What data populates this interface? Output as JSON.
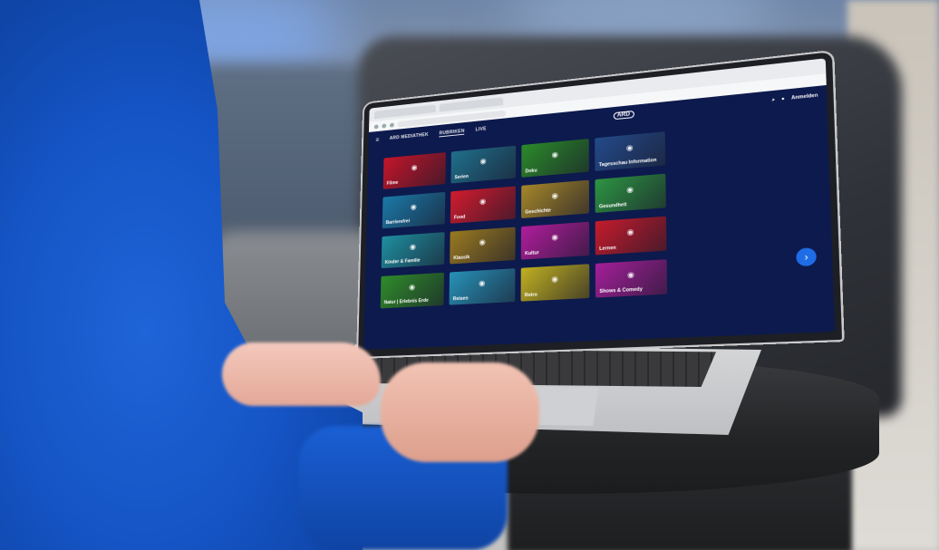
{
  "scene": {
    "description_colors": {
      "sleeve": "#1555c6",
      "screen_bg": "#0d1a4d",
      "accent_button": "#1f6de6"
    }
  },
  "app": {
    "nav": {
      "brand": "ARD MEDIATHEK",
      "items": [
        {
          "label": "RUBRIKEN",
          "active": true
        },
        {
          "label": "LIVE",
          "active": false
        }
      ],
      "logo": "ARD",
      "login": "Anmelden"
    },
    "tiles": [
      {
        "label": "Filme",
        "icon": "film-icon",
        "color": "#c4152a"
      },
      {
        "label": "Serien",
        "icon": "person-icon",
        "color": "#1f6f8c"
      },
      {
        "label": "Doku",
        "icon": "camera-icon",
        "color": "#2b8a2a"
      },
      {
        "label": "Tagesschau Information",
        "icon": "news-icon",
        "color": "#234a8a"
      },
      {
        "label": "Barrierefrei",
        "icon": "accessibility-icon",
        "color": "#1b79a8"
      },
      {
        "label": "Food",
        "icon": "food-icon",
        "color": "#d21b2e"
      },
      {
        "label": "Geschichte",
        "icon": "history-icon",
        "color": "#a5862a"
      },
      {
        "label": "Gesundheit",
        "icon": "health-icon",
        "color": "#2d9442"
      },
      {
        "label": "Kinder & Familie",
        "icon": "family-icon",
        "color": "#1e8fa0"
      },
      {
        "label": "Klassik",
        "icon": "music-icon",
        "color": "#9a7a20"
      },
      {
        "label": "Kultur",
        "icon": "culture-icon",
        "color": "#b01d9c"
      },
      {
        "label": "Lernen",
        "icon": "learn-icon",
        "color": "#c51b2c"
      },
      {
        "label": "Natur | Erlebnis Erde",
        "icon": "nature-icon",
        "color": "#2f8c2a"
      },
      {
        "label": "Reisen",
        "icon": "travel-icon",
        "color": "#2792b8"
      },
      {
        "label": "Retro",
        "icon": "retro-icon",
        "color": "#c1b020"
      },
      {
        "label": "Shows & Comedy",
        "icon": "shows-icon",
        "color": "#a41f9a"
      }
    ],
    "next_glyph": "›",
    "hamburger_glyph": "≡",
    "search_glyph": "⌕",
    "user_glyph": "●"
  }
}
